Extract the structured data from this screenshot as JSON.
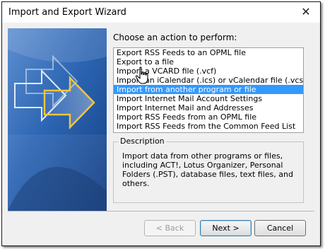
{
  "window": {
    "title": "Import and Export Wizard",
    "close_icon": "close-icon"
  },
  "prompt": "Choose an action to perform:",
  "actions": [
    "Export RSS Feeds to an OPML file",
    "Export to a file",
    "Import a VCARD file (.vcf)",
    "Import an iCalendar (.ics) or vCalendar file (.vcs)",
    "Import from another program or file",
    "Import Internet Mail Account Settings",
    "Import Internet Mail and Addresses",
    "Import RSS Feeds from an OPML file",
    "Import RSS Feeds from the Common Feed List"
  ],
  "selected_index": 4,
  "description": {
    "label": "Description",
    "text": "Import data from other programs or files, including ACT!, Lotus Organizer, Personal Folders (.PST), database files, text files, and others."
  },
  "buttons": {
    "back": "< Back",
    "next": "Next >",
    "cancel": "Cancel"
  },
  "colors": {
    "selection": "#3399ff",
    "banner_blue": "#2b68b5",
    "arrow": "#f2c43d"
  }
}
